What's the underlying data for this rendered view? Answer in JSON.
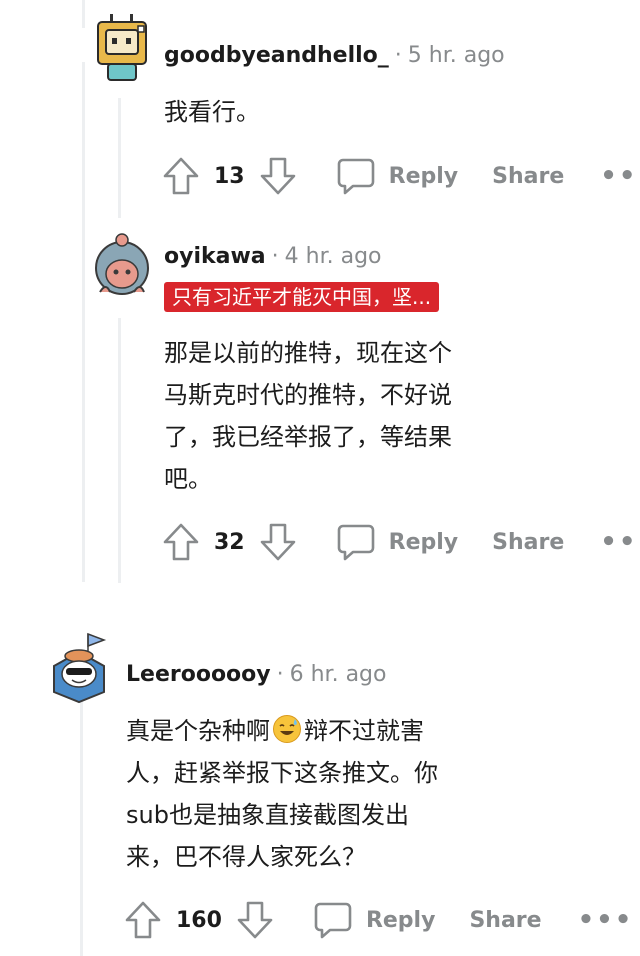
{
  "comments": [
    {
      "username": "goodbyeandhello_",
      "separator": "·",
      "time": "5 hr. ago",
      "flair": "",
      "body_lines": [
        "我看行。"
      ],
      "votes": "13",
      "reply_label": "Reply",
      "share_label": "Share",
      "more_label": "•••"
    },
    {
      "username": "oyikawa",
      "separator": "·",
      "time": "4 hr. ago",
      "flair": "只有习近平才能灭中国，坚...",
      "body_lines": [
        "那是以前的推特，现在这个",
        "马斯克时代的推特，不好说",
        "了，我已经举报了，等结果",
        "吧。"
      ],
      "votes": "32",
      "reply_label": "Reply",
      "share_label": "Share",
      "more_label": "•••"
    },
    {
      "username": "Leeroooooy",
      "separator": "·",
      "time": "6 hr. ago",
      "flair": "",
      "body_line1_a": "真是个杂种啊",
      "body_line1_b": "辩不过就害",
      "body_lines": [
        "人，赶紧举报下这条推文。你",
        "sub也是抽象直接截图发出",
        "来，巴不得人家死么？"
      ],
      "emoji": "sweat-smile-emoji",
      "votes": "160",
      "reply_label": "Reply",
      "share_label": "Share",
      "more_label": "•••"
    }
  ],
  "colors": {
    "flair_bg": "#d9262c",
    "meta_gray": "#878a8c",
    "text": "#1c1c1c",
    "thread_line": "#edeff1"
  }
}
